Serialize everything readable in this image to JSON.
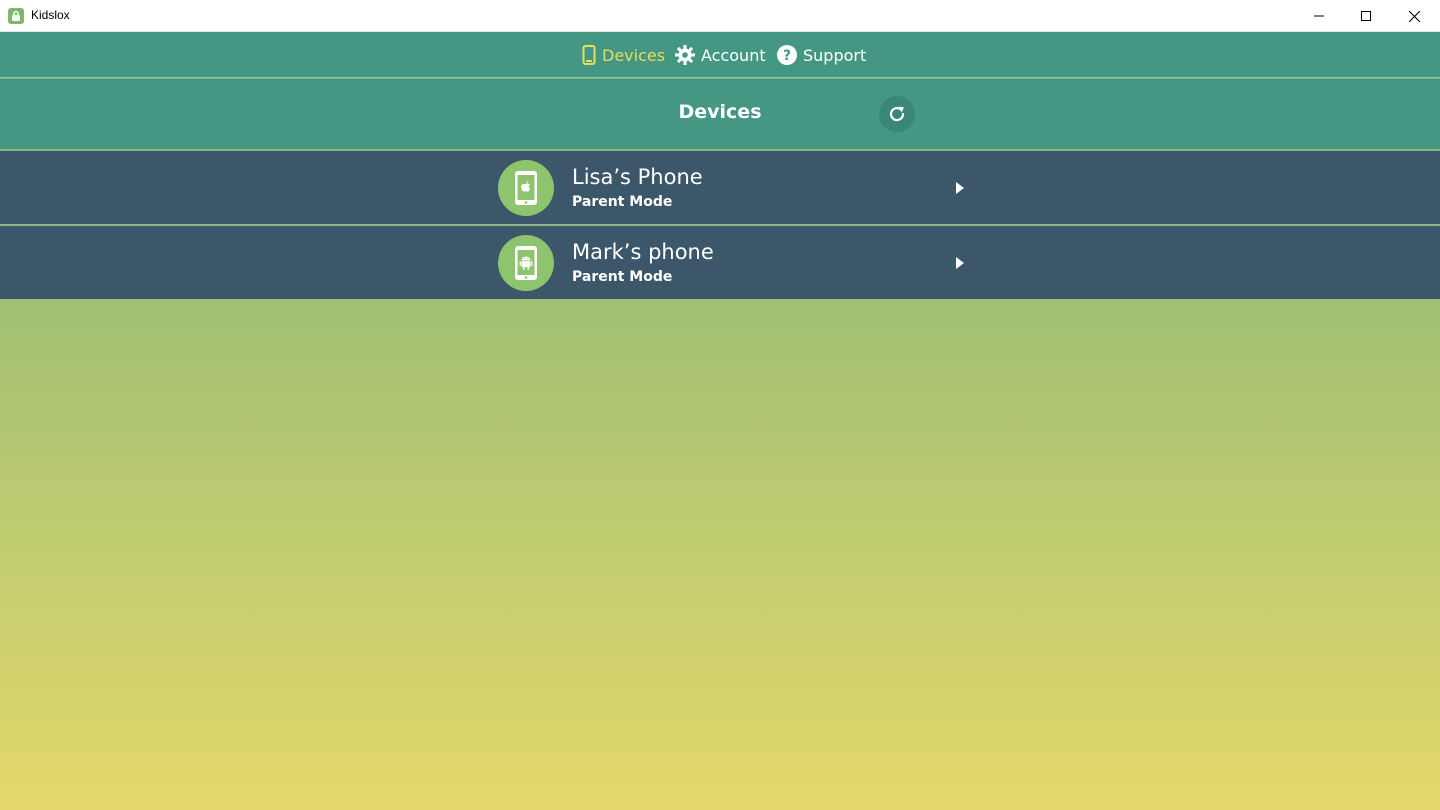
{
  "window": {
    "title": "Kidslox",
    "icons": [
      "lock-icon",
      "minimize-icon",
      "maximize-icon",
      "close-icon"
    ]
  },
  "nav": {
    "items": [
      {
        "label": "Devices",
        "icon": "phone-icon",
        "active": true
      },
      {
        "label": "Account",
        "icon": "gear-icon",
        "active": false
      },
      {
        "label": "Support",
        "icon": "question-icon",
        "active": false
      }
    ]
  },
  "header": {
    "title": "Devices",
    "refresh_icon": "refresh-icon"
  },
  "devices": [
    {
      "name": "Lisa’s Phone",
      "mode": "Parent Mode",
      "platform_icon": "apple-phone-icon"
    },
    {
      "name": "Mark’s phone",
      "mode": "Parent Mode",
      "platform_icon": "android-phone-icon"
    }
  ],
  "colors": {
    "nav_bg": "#449883",
    "active_nav": "#e8dd5c",
    "row_bg": "#3b5769",
    "avatar_bg": "#8fc46e",
    "gradient_top": "#7aac78",
    "gradient_bottom": "#e4d86a"
  }
}
